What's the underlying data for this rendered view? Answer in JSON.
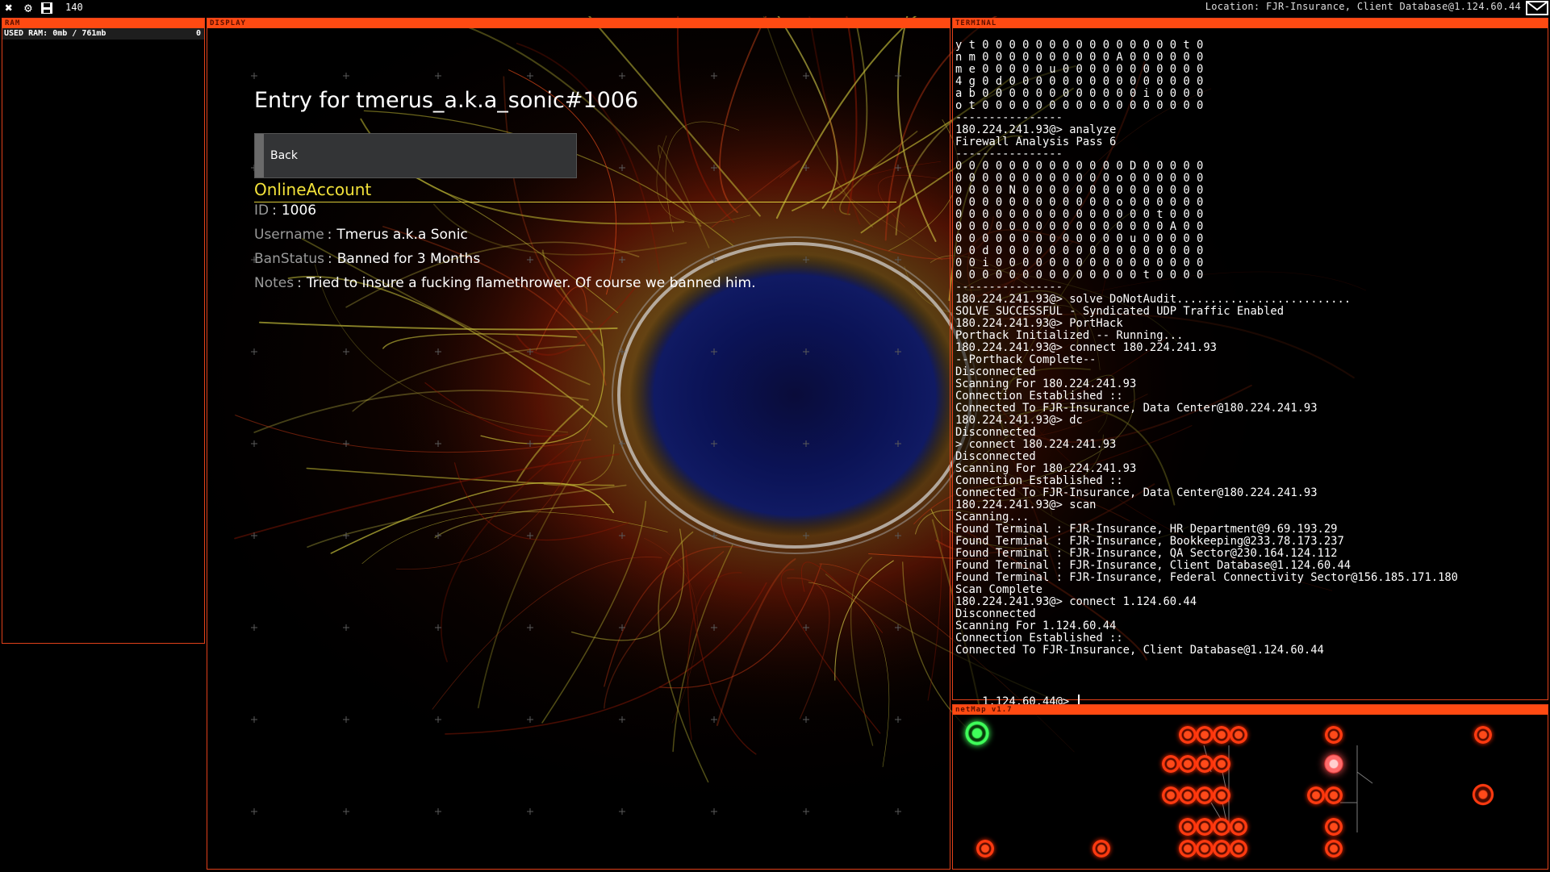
{
  "topbar": {
    "ram_count": "140",
    "location": "Location: FJR-Insurance, Client Database@1.124.60.44"
  },
  "panels": {
    "ram_label": "RAM",
    "display_label": "DISPLAY",
    "terminal_label": "TERMINAL",
    "netmap_label": "netMap v1.7"
  },
  "ram": {
    "used_text": "USED RAM: 0mb / 761mb",
    "count": "0"
  },
  "display": {
    "entry_title": "Entry for tmerus_a.k.a_sonic#1006",
    "back_label": "Back",
    "account_title": "OnlineAccount",
    "separator": ":",
    "fields": [
      {
        "key": "ID",
        "value": "1006"
      },
      {
        "key": "Username",
        "value": "Tmerus a.k.a Sonic"
      },
      {
        "key": "BanStatus",
        "value": "Banned for 3 Months"
      },
      {
        "key": "Notes",
        "value": "Tried to insure a fucking flamethrower. Of course we banned him."
      }
    ]
  },
  "terminal": {
    "lines": [
      "y t 0 0 0 0 0 0 0 0 0 0 0 0 0 0 0 t 0",
      "n m 0 0 0 0 0 0 0 0 0 0 A 0 0 0 0 0 0",
      "m e 0 0 0 0 0 u 0 0 0 0 0 0 0 0 0 0 0",
      "4 g 0 d 0 0 0 0 0 0 0 0 0 0 0 0 0 0 0",
      "a b 0 0 0 0 0 0 0 0 0 0 0 0 i 0 0 0 0",
      "o t 0 0 0 0 0 0 0 0 0 0 0 0 0 0 0 0 0",
      "----------------",
      "180.224.241.93@> analyze",
      "Firewall Analysis Pass 6",
      "----------------",
      "0 0 0 0 0 0 0 0 0 0 0 0 0 D 0 0 0 0 0",
      "0 0 0 0 0 0 0 0 0 0 0 0 o 0 0 0 0 0 0",
      "0 0 0 0 N 0 0 0 0 0 0 0 0 0 0 0 0 0 0",
      "0 0 0 0 0 0 0 0 0 0 0 0 o 0 0 0 0 0 0",
      "0 0 0 0 0 0 0 0 0 0 0 0 0 0 0 t 0 0 0",
      "0 0 0 0 0 0 0 0 0 0 0 0 0 0 0 0 A 0 0",
      "0 0 0 0 0 0 0 0 0 0 0 0 0 u 0 0 0 0 0",
      "0 0 d 0 0 0 0 0 0 0 0 0 0 0 0 0 0 0 0",
      "0 0 i 0 0 0 0 0 0 0 0 0 0 0 0 0 0 0 0",
      "0 0 0 0 0 0 0 0 0 0 0 0 0 0 t 0 0 0 0",
      "----------------",
      "180.224.241.93@> solve DoNotAudit..........................",
      "SOLVE SUCCESSFUL - Syndicated UDP Traffic Enabled",
      "180.224.241.93@> PortHack",
      "Porthack Initialized -- Running...",
      "180.224.241.93@> connect 180.224.241.93",
      "--Porthack Complete--",
      "Disconnected",
      "Scanning For 180.224.241.93",
      "Connection Established ::",
      "Connected To FJR-Insurance, Data Center@180.224.241.93",
      "180.224.241.93@> dc",
      "Disconnected",
      "> connect 180.224.241.93",
      "Disconnected",
      "Scanning For 180.224.241.93",
      "Connection Established ::",
      "Connected To FJR-Insurance, Data Center@180.224.241.93",
      "180.224.241.93@> scan",
      "Scanning...",
      "Found Terminal : FJR-Insurance, HR Department@9.69.193.29",
      "Found Terminal : FJR-Insurance, Bookkeeping@233.78.173.237",
      "Found Terminal : FJR-Insurance, QA Sector@230.164.124.112",
      "Found Terminal : FJR-Insurance, Client Database@1.124.60.44",
      "Found Terminal : FJR-Insurance, Federal Connectivity Sector@156.185.171.180",
      "Scan Complete",
      "180.224.241.93@> connect 1.124.60.44",
      "Disconnected",
      "Scanning For 1.124.60.44",
      "Connection Established ::",
      "Connected To FJR-Insurance, Client Database@1.124.60.44"
    ],
    "prompt": "1.124.60.44@>"
  },
  "colors": {
    "accent": "#ff4a12",
    "highlight": "#f3e23a",
    "node_red": "#ff3a10",
    "node_home": "#3fff5a",
    "node_current": "#ff8080"
  },
  "icons": [
    "close-icon",
    "settings-gear-icon",
    "save-disk-icon",
    "mail-icon"
  ]
}
